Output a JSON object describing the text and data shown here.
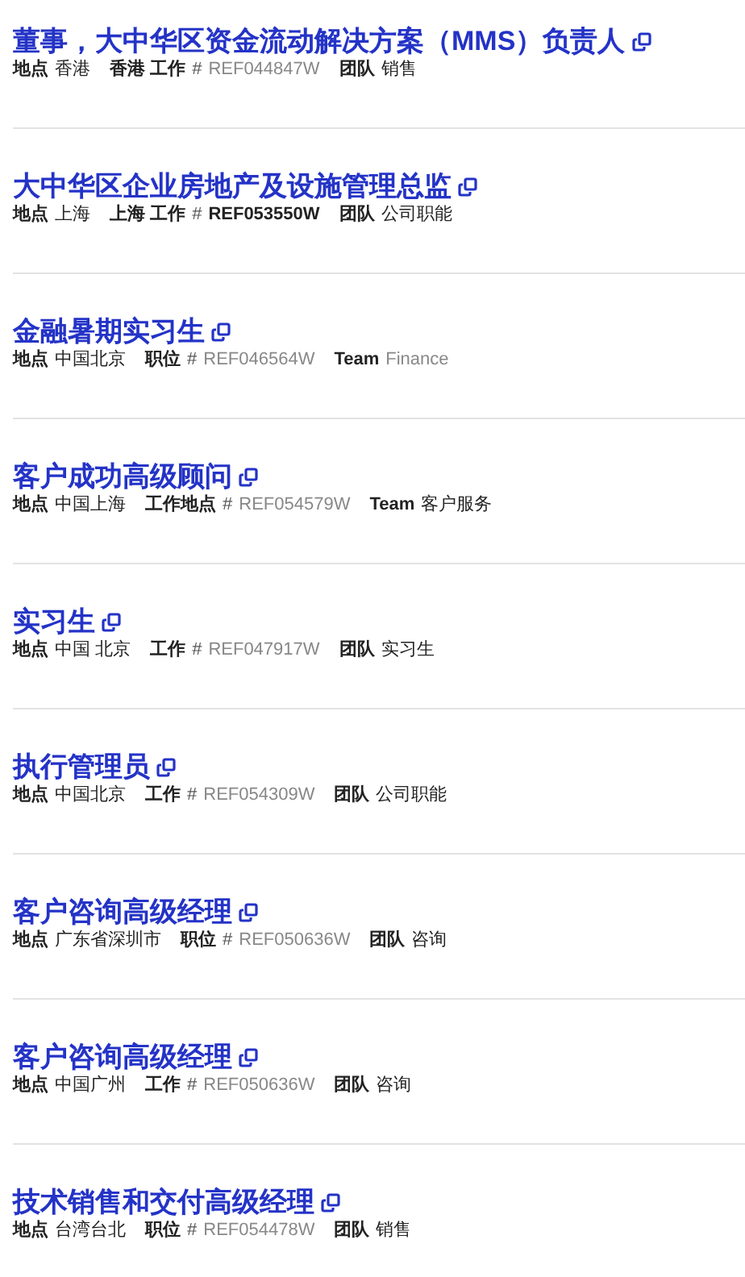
{
  "jobs": [
    {
      "title": "董事，大中华区资金流动解决方案（MMS）负责人",
      "location_label": "地点",
      "location": "香港",
      "id_label": "香港 工作",
      "hash": "#",
      "ref": "REF044847W",
      "ref_bold": false,
      "team_label": "团队",
      "team": "销售",
      "team_muted": false
    },
    {
      "title": "大中华区企业房地产及设施管理总监",
      "location_label": "地点",
      "location": "上海",
      "id_label": "上海 工作",
      "hash": "#",
      "ref": "REF053550W",
      "ref_bold": true,
      "team_label": "团队",
      "team": "公司职能",
      "team_muted": false
    },
    {
      "title": "金融暑期实习生",
      "location_label": "地点",
      "location": "中国北京",
      "id_label": "职位",
      "hash": "#",
      "ref": "REF046564W",
      "ref_bold": false,
      "team_label": "Team",
      "team": "Finance",
      "team_muted": true
    },
    {
      "title": "客户成功高级顾问",
      "location_label": "地点",
      "location": "中国上海",
      "id_label": "工作地点",
      "hash": "#",
      "ref": "REF054579W",
      "ref_bold": false,
      "team_label": "Team",
      "team": "客户服务",
      "team_muted": false
    },
    {
      "title": "实习生",
      "location_label": "地点",
      "location": "中国 北京",
      "id_label": "工作",
      "hash": "#",
      "ref": "REF047917W",
      "ref_bold": false,
      "team_label": "团队",
      "team": "实习生",
      "team_muted": false
    },
    {
      "title": "执行管理员",
      "location_label": "地点",
      "location": "中国北京",
      "id_label": "工作",
      "hash": "#",
      "ref": "REF054309W",
      "ref_bold": false,
      "team_label": "团队",
      "team": "公司职能",
      "team_muted": false
    },
    {
      "title": "客户咨询高级经理",
      "location_label": "地点",
      "location": "广东省深圳市",
      "id_label": "职位",
      "hash": "#",
      "ref": "REF050636W",
      "ref_bold": false,
      "team_label": "团队",
      "team": "咨询",
      "team_muted": false
    },
    {
      "title": "客户咨询高级经理",
      "location_label": "地点",
      "location": "中国广州",
      "id_label": "工作",
      "hash": "#",
      "ref": "REF050636W",
      "ref_bold": false,
      "team_label": "团队",
      "team": "咨询",
      "team_muted": false
    },
    {
      "title": "技术销售和交付高级经理",
      "location_label": "地点",
      "location": "台湾台北",
      "id_label": "职位",
      "hash": "#",
      "ref": "REF054478W",
      "ref_bold": false,
      "team_label": "团队",
      "team": "销售",
      "team_muted": false
    }
  ]
}
